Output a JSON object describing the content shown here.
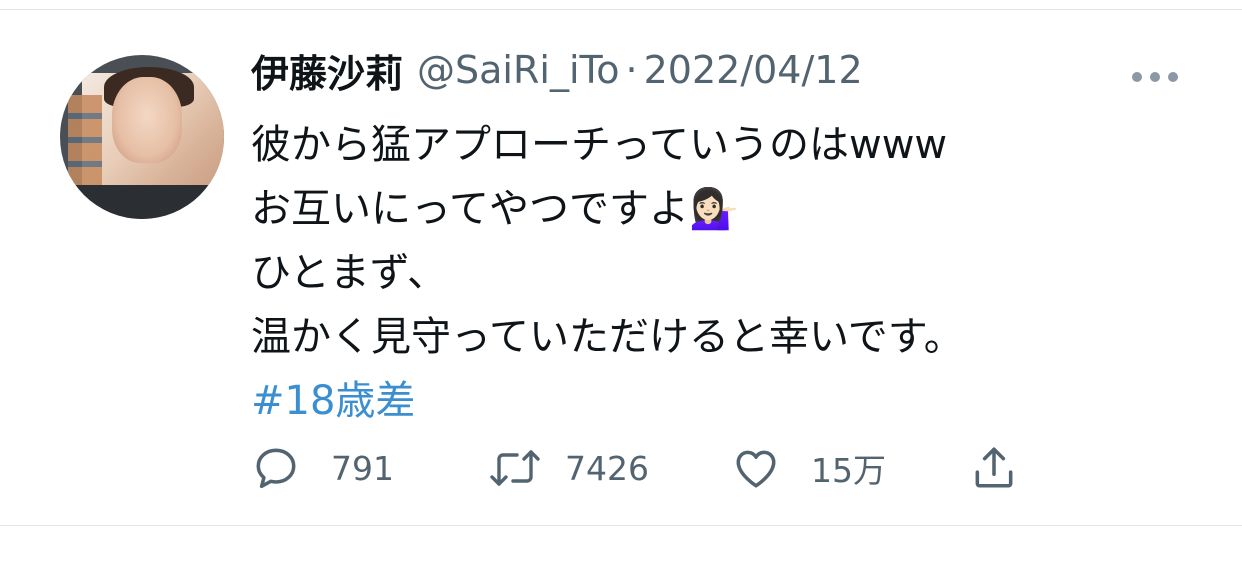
{
  "tweet": {
    "display_name": "伊藤沙莉",
    "handle": "@SaiRi_iTo",
    "separator": "·",
    "date": "2022/04/12",
    "lines": [
      "彼から猛アプローチっていうのはwww",
      "お互いにってやつですよ💁🏻‍♀️",
      "ひとまず、",
      "温かく見守っていただけると幸いです。"
    ],
    "hashtag": "#18歳差"
  },
  "actions": {
    "reply_count": "791",
    "retweet_count": "7426",
    "like_count": "15万"
  },
  "icons": {
    "avatar": "profile-photo",
    "more": "more-horizontal-icon",
    "reply": "reply-icon",
    "retweet": "retweet-icon",
    "like": "heart-icon",
    "share": "share-icon"
  },
  "colors": {
    "text": "#0f1419",
    "secondary": "#536471",
    "link": "#3b8fd0",
    "divider": "#e1e4e8"
  }
}
